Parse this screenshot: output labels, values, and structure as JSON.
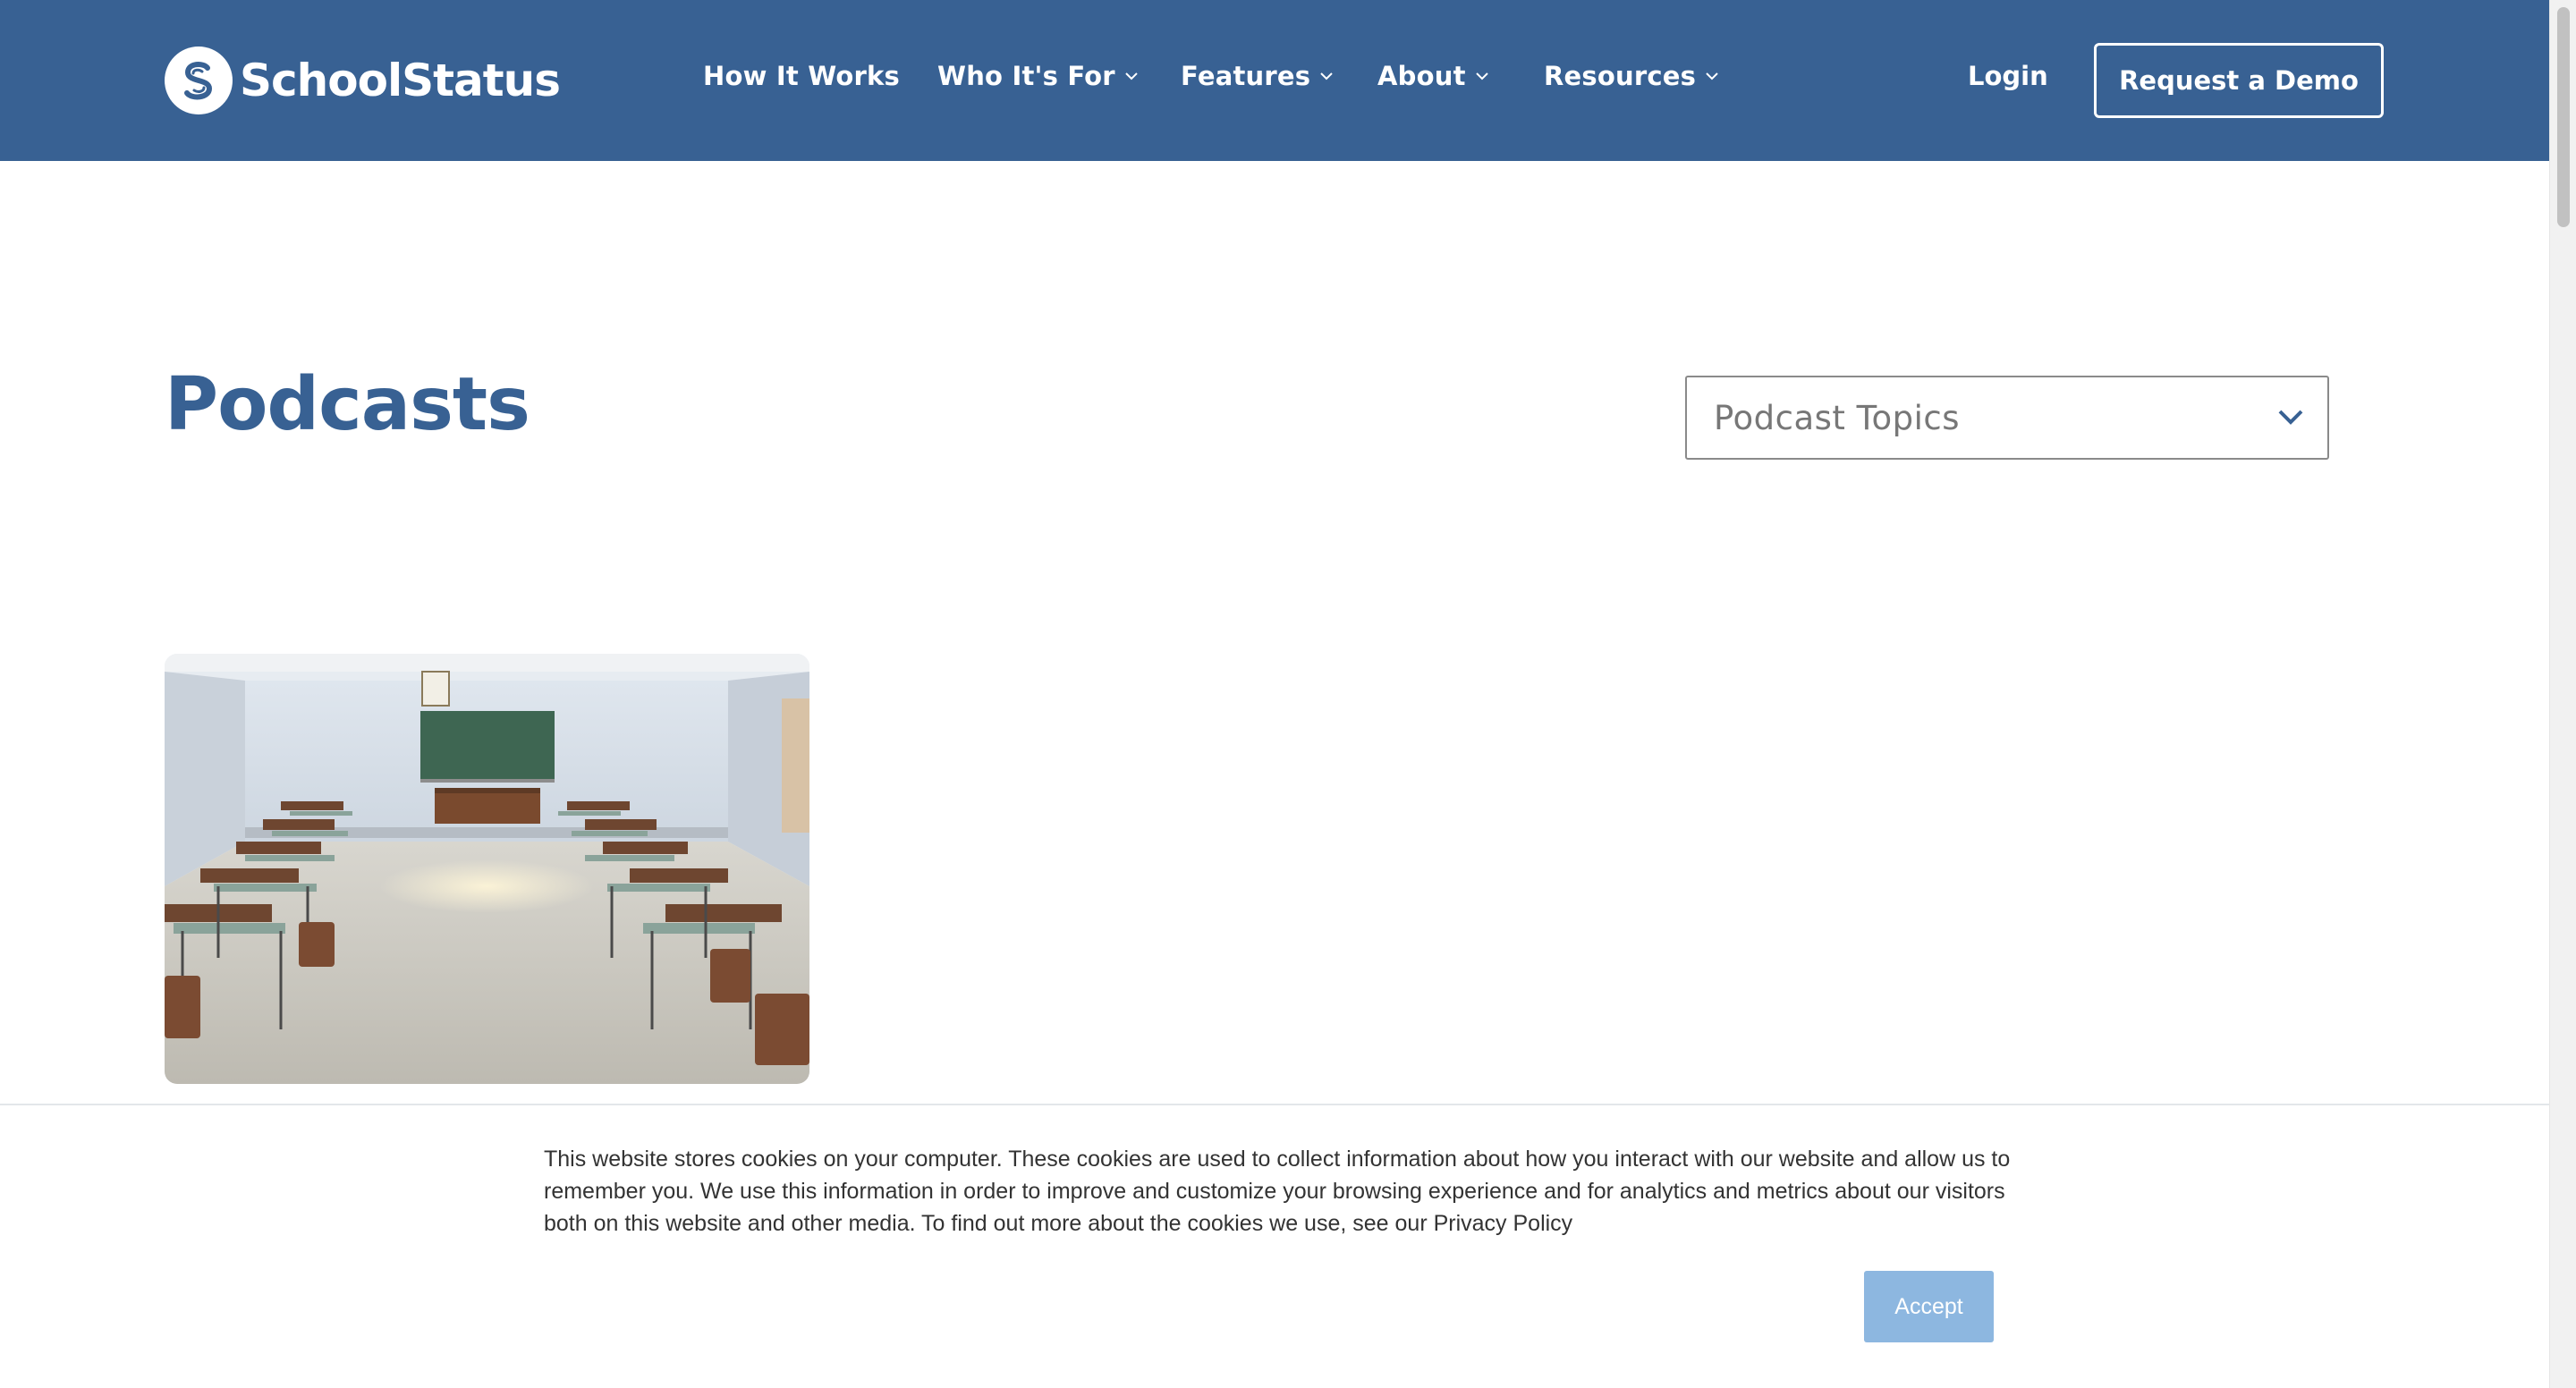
{
  "brand": {
    "name": "SchoolStatus",
    "color": "#386193"
  },
  "nav": {
    "items": [
      {
        "label": "How It Works",
        "dropdown": false
      },
      {
        "label": "Who It's For",
        "dropdown": true
      },
      {
        "label": "Features",
        "dropdown": true
      },
      {
        "label": "About",
        "dropdown": true
      },
      {
        "label": "Resources",
        "dropdown": true
      }
    ],
    "login": "Login",
    "cta": "Request a Demo"
  },
  "main": {
    "title": "Podcasts",
    "topics_select": {
      "placeholder": "Podcast Topics",
      "icon": "chevron-down-icon"
    },
    "cards": [
      {
        "image": "classroom-photo"
      }
    ]
  },
  "cookie_banner": {
    "text": "This website stores cookies on your computer. These cookies are used to collect information about how you interact with our website and allow us to remember you. We use this information in order to improve and customize your browsing experience and for analytics and metrics about our visitors both on this website and other media. To find out more about the cookies we use, see our Privacy Policy",
    "accept_label": "Accept",
    "accept_color": "#8db7e0"
  }
}
